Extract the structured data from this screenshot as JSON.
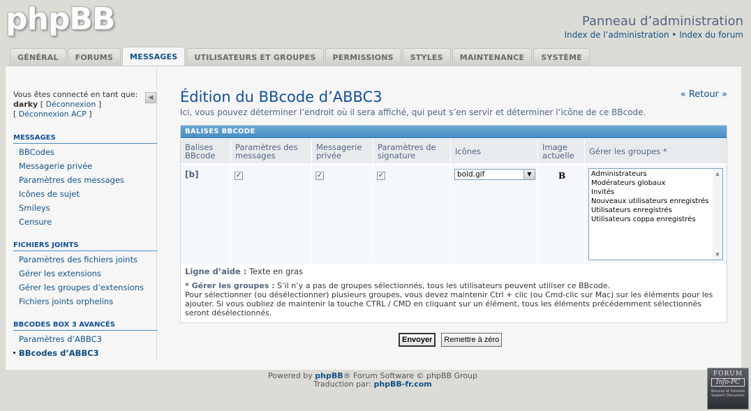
{
  "header": {
    "logo": "phpBB",
    "panel_title": "Panneau d’administration",
    "link_admin_index": "Index de l’administration",
    "link_separator": "•",
    "link_forum_index": "Index du forum"
  },
  "tabs": [
    {
      "label": "GÉNÉRAL"
    },
    {
      "label": "FORUMS"
    },
    {
      "label": "MESSAGES",
      "active": true
    },
    {
      "label": "UTILISATEURS ET GROUPES"
    },
    {
      "label": "PERMISSIONS"
    },
    {
      "label": "STYLES"
    },
    {
      "label": "MAINTENANCE"
    },
    {
      "label": "SYSTÈME"
    }
  ],
  "sidebar": {
    "logged_as": "Vous êtes connecté en tant que:",
    "username": "darky",
    "logout": "Déconnexion",
    "logout_acp": "Déconnexion ACP",
    "sections": [
      {
        "title": "MESSAGES",
        "items": [
          "BBCodes",
          "Messagerie privée",
          "Paramètres des messages",
          "Icônes de sujet",
          "Smileys",
          "Censure"
        ]
      },
      {
        "title": "FICHIERS JOINTS",
        "items": [
          "Paramètres des fichiers joints",
          "Gérer les extensions",
          "Gérer les groupes d’extensions",
          "Fichiers joints orphelins"
        ]
      },
      {
        "title": "BBCODES BOX 3 AVANCÉS",
        "items": [
          "Paramètres d’ABBC3",
          "BBcodes d’ABBC3"
        ]
      }
    ]
  },
  "main": {
    "title": "Édition du BBcode d’ABBC3",
    "back": "« Retour »",
    "intro": "Ici, vous pouvez déterminer l’endroit où il sera affiché, qui peut s’en servir et déterminer l’icône de ce BBcode.",
    "table_title": "BALISES BBCODE",
    "columns": [
      {
        "l1": "Balises",
        "l2": "BBcode"
      },
      {
        "l1": "Paramètres des",
        "l2": "messages"
      },
      {
        "l1": "Messagerie",
        "l2": "privée"
      },
      {
        "l1": "Paramètres de",
        "l2": "signature"
      },
      {
        "l1": "Icônes",
        "l2": ""
      },
      {
        "l1": "Image",
        "l2": "actuelle"
      },
      {
        "l1": "Gérer les groupes *",
        "l2": ""
      }
    ],
    "row": {
      "tag": "[b]",
      "messages_checked": true,
      "pm_checked": true,
      "signature_checked": true,
      "icon_value": "bold.gif",
      "current_image": "B"
    },
    "groups": [
      "Administrateurs",
      "Modérateurs globaux",
      "Invités",
      "Nouveaux utilisateurs enregistrés",
      "Utilisateurs enregistrés",
      "Utilisateurs coppa enregistrés"
    ],
    "help_label": "Ligne d’aide :",
    "help_value": "Texte en gras",
    "note_label": "* Gérer les groupes :",
    "note_line1": "S’il n’y a pas de groupes sélectionnés, tous les utilisateurs peuvent utiliser ce BBcode.",
    "note_line2": "Pour sélectionner (ou désélectionner) plusieurs groupes, vous devez maintenir Ctrl + clic (ou Cmd-clic sur Mac) sur les éléments pour les ajouter. Si vous oubliez de maintenir la touche CTRL / CMD en cliquant sur un élément, tous les éléments précédemment sélectionnés seront désélectionnés.",
    "submit": "Envoyer",
    "reset": "Remettre à zéro"
  },
  "footer": {
    "powered_pre": "Powered by",
    "phpbb": "phpBB",
    "powered_post": "® Forum Software © phpBB Group",
    "translation_pre": "Traduction par:",
    "translation_link": "phpBB-fr.com"
  },
  "badge": {
    "line1": "FORUM",
    "line2": "Info-PC",
    "line3": "Astuces et tutoriels Support Discussion"
  }
}
